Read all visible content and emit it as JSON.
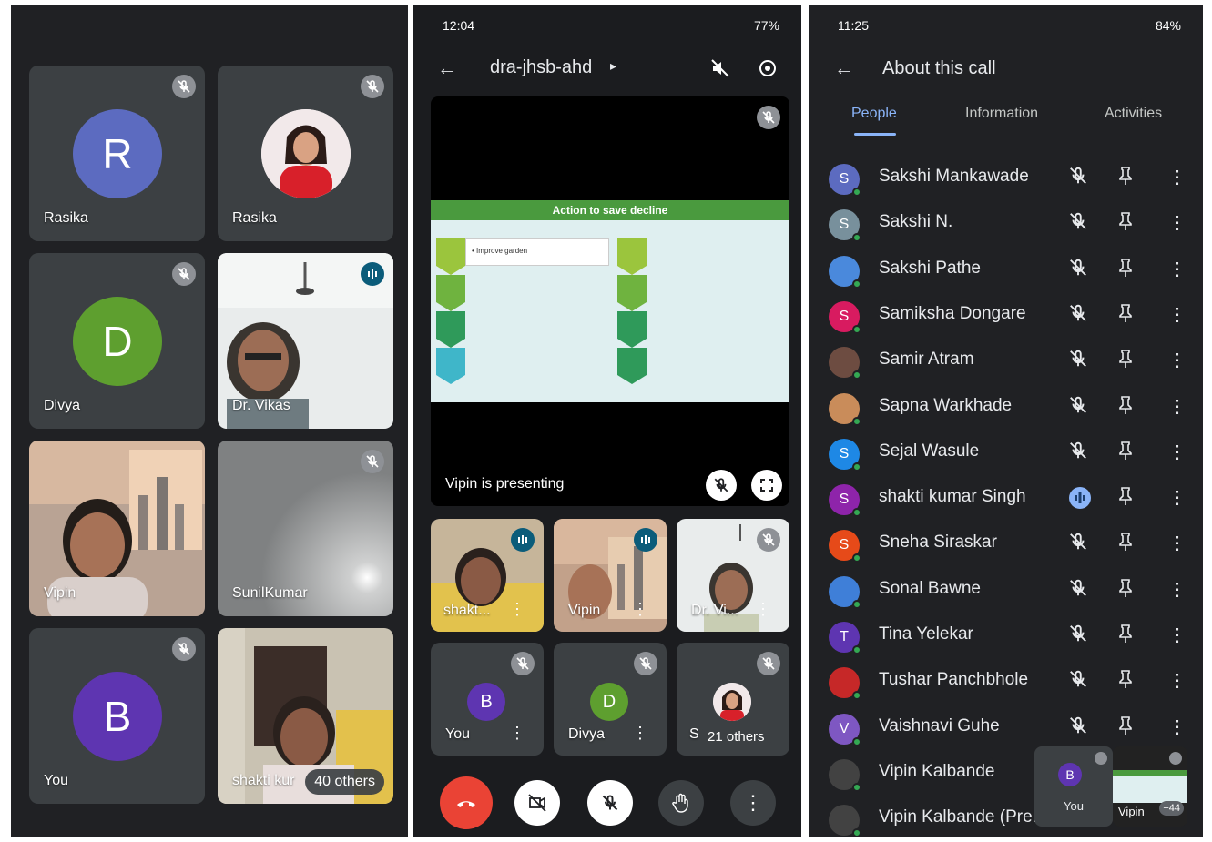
{
  "panel1": {
    "tiles": [
      {
        "name": "Rasika",
        "initial": "R",
        "color": "#5c6bc0"
      },
      {
        "name": "Rasika"
      },
      {
        "name": "Divya",
        "initial": "D",
        "color": "#5e9f2f"
      },
      {
        "name": "Dr. Vikas"
      },
      {
        "name": "Vipin"
      },
      {
        "name": "SunilKumar"
      },
      {
        "name": "You",
        "initial": "B",
        "color": "#5e35b1"
      },
      {
        "name": "shakti kur",
        "others": "40 others"
      }
    ]
  },
  "panel2": {
    "status_time": "12:04",
    "status_battery": "77%",
    "meeting_code": "dra-jhsb-ahd",
    "slide_title": "Action to save decline",
    "slide_bullet": "Improve garden",
    "presenting_text": "Vipin is presenting",
    "thumbs": [
      {
        "name": "shakt..."
      },
      {
        "name": "Vipin"
      },
      {
        "name": "Dr. Vi..."
      },
      {
        "name": "You",
        "initial": "B",
        "color": "#5e35b1"
      },
      {
        "name": "Divya",
        "initial": "D",
        "color": "#5e9f2f"
      },
      {
        "name": "S",
        "others": "21 others"
      }
    ]
  },
  "panel3": {
    "status_time": "11:25",
    "status_battery": "84%",
    "title": "About this call",
    "tabs": [
      "People",
      "Information",
      "Activities"
    ],
    "people": [
      {
        "name": "Sakshi Mankawade",
        "initial": "S",
        "color": "#5c6bc0"
      },
      {
        "name": "Sakshi N.",
        "initial": "S",
        "color": "#78909c"
      },
      {
        "name": "Sakshi Pathe",
        "initial": "",
        "color": "#4a89dc"
      },
      {
        "name": "Samiksha Dongare",
        "initial": "S",
        "color": "#d81b60"
      },
      {
        "name": "Samir Atram",
        "initial": "",
        "color": "#6d4c41"
      },
      {
        "name": "Sapna Warkhade",
        "initial": "",
        "color": "#c98c5a"
      },
      {
        "name": "Sejal Wasule",
        "initial": "S",
        "color": "#1e88e5"
      },
      {
        "name": "shakti kumar Singh",
        "initial": "S",
        "color": "#8e24aa",
        "speaking": true
      },
      {
        "name": "Sneha Siraskar",
        "initial": "S",
        "color": "#e64a19"
      },
      {
        "name": "Sonal Bawne",
        "initial": "",
        "color": "#3f7fd8"
      },
      {
        "name": "Tina Yelekar",
        "initial": "T",
        "color": "#5e35b1"
      },
      {
        "name": "Tushar Panchbhole",
        "initial": "",
        "color": "#c62828"
      },
      {
        "name": "Vaishnavi Guhe",
        "initial": "V",
        "color": "#7e57c2"
      },
      {
        "name": "Vipin Kalbande",
        "initial": "",
        "color": "#424242"
      },
      {
        "name": "Vipin Kalbande (Pre...",
        "initial": "",
        "color": "#424242"
      }
    ],
    "pip": {
      "self_initial": "B",
      "self_label": "You",
      "other_label": "Vipin",
      "count": "+44"
    }
  }
}
